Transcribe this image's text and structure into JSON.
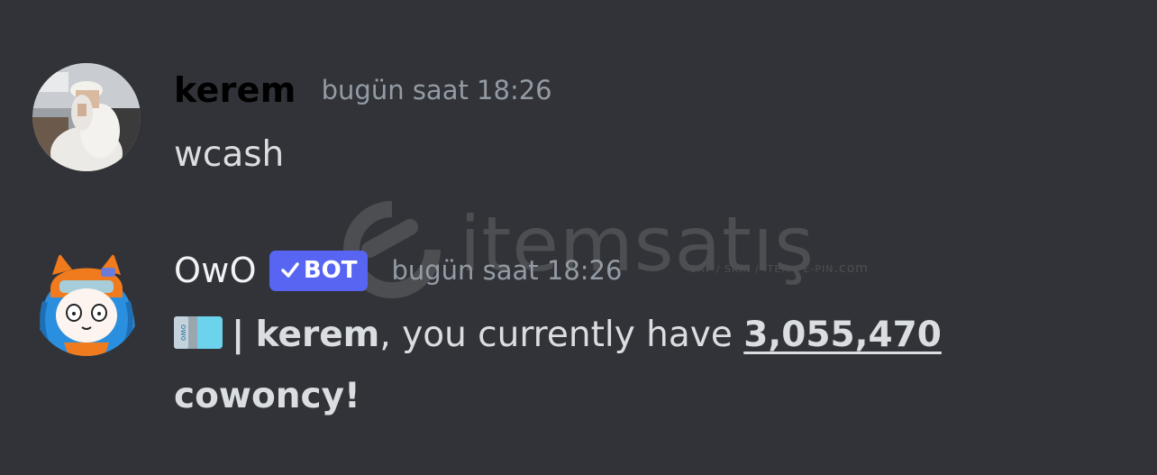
{
  "messages": [
    {
      "username": "kerem",
      "timestamp": "bugün saat 18:26",
      "content": "wcash"
    },
    {
      "username": "OwO",
      "badge": "BOT",
      "timestamp": "bugün saat 18:26",
      "separator": "|",
      "mention_name": "kerem",
      "text_middle": ", you currently have ",
      "amount": "3,055,470",
      "currency": "cowoncy!"
    }
  ],
  "watermark": {
    "brand": "itemsatış",
    "tagline": "SAP / SKIN / ITEM / E-PIN",
    "domain": ".com"
  },
  "colors": {
    "background": "#313338",
    "bot_badge": "#5865f2",
    "timestamp": "#949ba4",
    "text": "#dbdee1"
  }
}
